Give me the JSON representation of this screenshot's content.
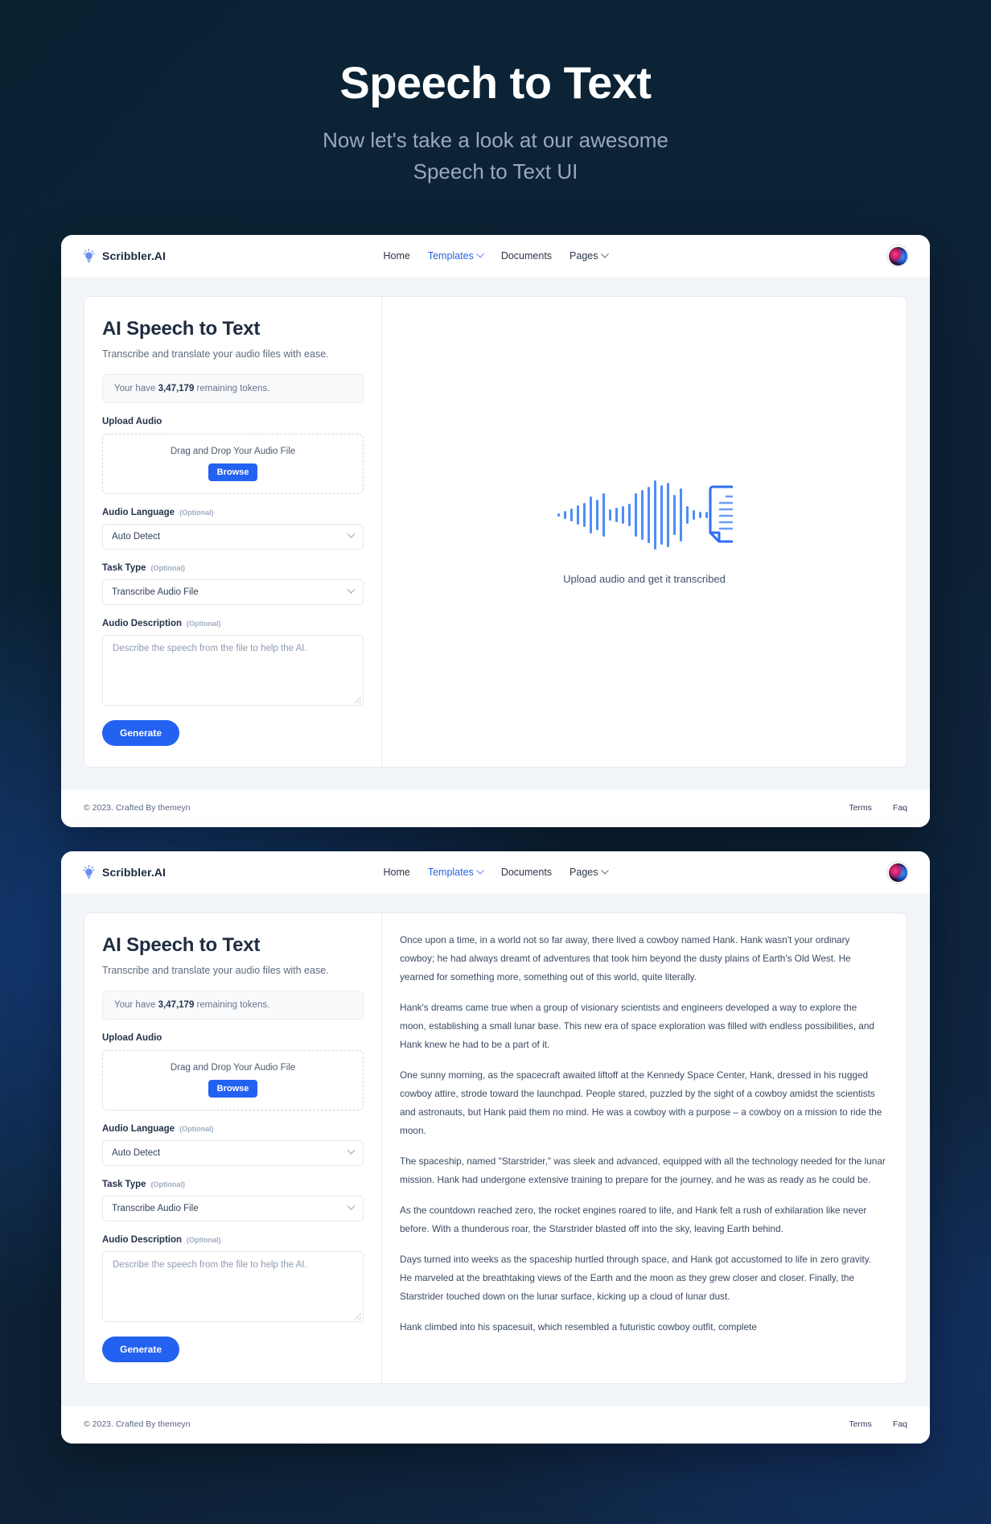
{
  "hero": {
    "title": "Speech to Text",
    "subtitle_line1": "Now let's take a look at our awesome",
    "subtitle_line2": "Speech to Text UI"
  },
  "navbar": {
    "brand": "Scribbler.AI",
    "brand_icon": "lightbulb-icon",
    "links": [
      {
        "label": "Home",
        "active": false,
        "has_caret": false
      },
      {
        "label": "Templates",
        "active": true,
        "has_caret": true
      },
      {
        "label": "Documents",
        "active": false,
        "has_caret": false
      },
      {
        "label": "Pages",
        "active": false,
        "has_caret": true
      }
    ],
    "avatar_alt": "user-avatar"
  },
  "form": {
    "title": "AI Speech to Text",
    "subtitle": "Transcribe and translate your audio files with ease.",
    "token_prefix": "Your have ",
    "token_count": "3,47,179",
    "token_suffix": " remaining tokens.",
    "upload_label": "Upload Audio",
    "dropzone_text": "Drag and Drop Your Audio File",
    "browse_label": "Browse",
    "language_label": "Audio Language",
    "language_optional": "(Optional)",
    "language_value": "Auto Detect",
    "task_label": "Task Type",
    "task_optional": "(Optional)",
    "task_value": "Transcribe Audio File",
    "description_label": "Audio Description",
    "description_optional": "(Optional)",
    "description_placeholder": "Describe the speech from the file to help the AI.",
    "generate_label": "Generate"
  },
  "placeholder": {
    "caption": "Upload audio and get it transcribed",
    "icon": "audio-waveform-to-document-icon"
  },
  "transcript": {
    "paragraphs": [
      "Once upon a time, in a world not so far away, there lived a cowboy named Hank. Hank wasn't your ordinary cowboy; he had always dreamt of adventures that took him beyond the dusty plains of Earth's Old West. He yearned for something more, something out of this world, quite literally.",
      "Hank's dreams came true when a group of visionary scientists and engineers developed a way to explore the moon, establishing a small lunar base. This new era of space exploration was filled with endless possibilities, and Hank knew he had to be a part of it.",
      "One sunny morning, as the spacecraft awaited liftoff at the Kennedy Space Center, Hank, dressed in his rugged cowboy attire, strode toward the launchpad. People stared, puzzled by the sight of a cowboy amidst the scientists and astronauts, but Hank paid them no mind. He was a cowboy with a purpose – a cowboy on a mission to ride the moon.",
      "The spaceship, named \"Starstrider,\" was sleek and advanced, equipped with all the technology needed for the lunar mission. Hank had undergone extensive training to prepare for the journey, and he was as ready as he could be.",
      "As the countdown reached zero, the rocket engines roared to life, and Hank felt a rush of exhilaration like never before. With a thunderous roar, the Starstrider blasted off into the sky, leaving Earth behind.",
      "Days turned into weeks as the spaceship hurtled through space, and Hank got accustomed to life in zero gravity. He marveled at the breathtaking views of the Earth and the moon as they grew closer and closer. Finally, the Starstrider touched down on the lunar surface, kicking up a cloud of lunar dust.",
      "Hank climbed into his spacesuit, which resembled a futuristic cowboy outfit, complete"
    ]
  },
  "footer": {
    "copyright": "© 2023. Crafted By themeyn",
    "links": [
      {
        "label": "Terms"
      },
      {
        "label": "Faq"
      }
    ]
  },
  "colors": {
    "accent_blue": "#2361f1",
    "link_blue": "#2563ec",
    "heading_navy": "#1f2c40",
    "page_bg_dark": "#0c2336",
    "work_bg": "#f2f5f9"
  }
}
